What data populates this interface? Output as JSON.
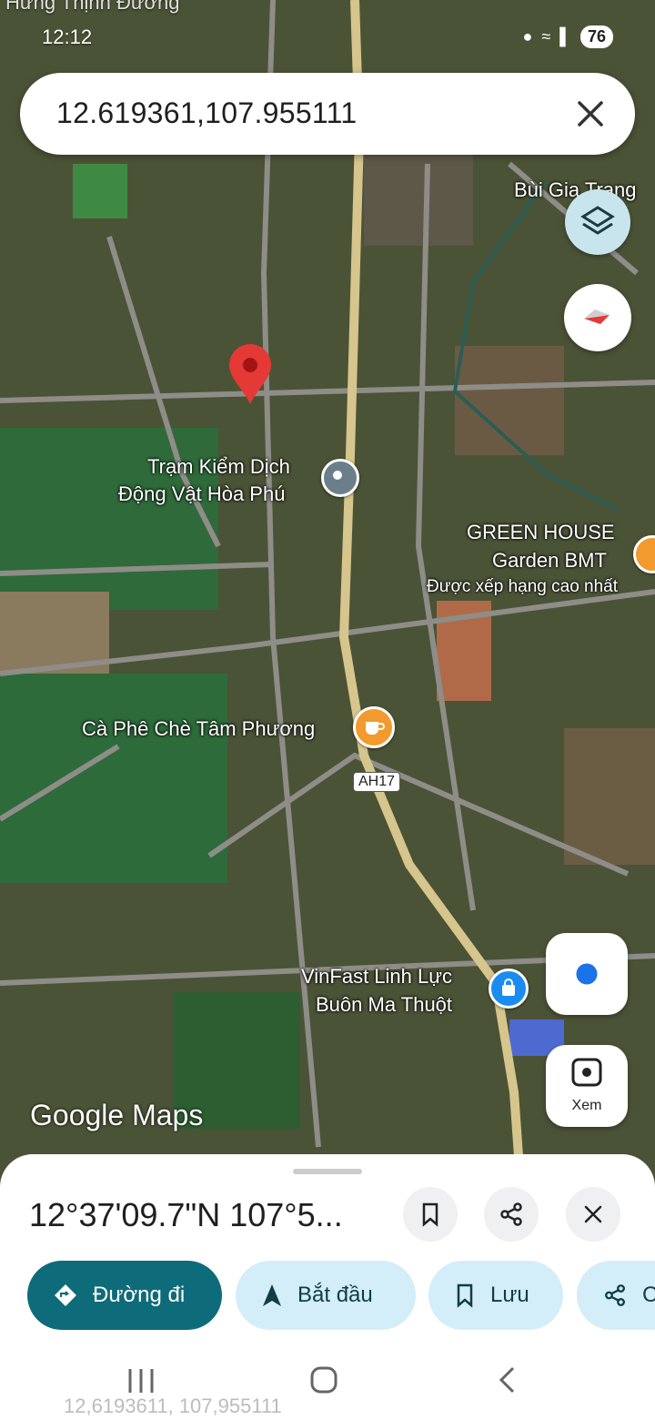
{
  "status": {
    "time": "12:12",
    "battery": "76"
  },
  "map": {
    "top_faded_label": "Hưng Thịnh Đường",
    "labels": {
      "bui_gia_trang": "Bùi Gia Trang",
      "tram_line1": "Trạm Kiểm Dịch",
      "tram_line2": "Động Vật Hòa Phú",
      "green_line1": "GREEN HOUSE",
      "green_line2": "Garden BMT",
      "green_line3": "Được xếp hạng cao nhất",
      "cafe": "Cà Phê Chè Tâm Phương",
      "road_shield": "AH17",
      "vinfast_line1": "VinFast Linh Lực",
      "vinfast_line2": "Buôn Ma Thuột"
    },
    "logo": "Google Maps",
    "lens_label": "Xem"
  },
  "search": {
    "value": "12.619361,107.955111"
  },
  "sheet": {
    "coords": "12°37'09.7\"N 107°5...",
    "chips": {
      "directions": "Đường đi",
      "start": "Bắt đầu",
      "save": "Lưu",
      "share": "C"
    }
  },
  "nav": {
    "ghost_text": "12,6193611, 107,955111"
  },
  "colors": {
    "accent": "#0e6b7a",
    "chip": "#d3eef8",
    "pin": "#e53935",
    "cafe": "#f29a2e",
    "shop": "#1a8cf0"
  }
}
